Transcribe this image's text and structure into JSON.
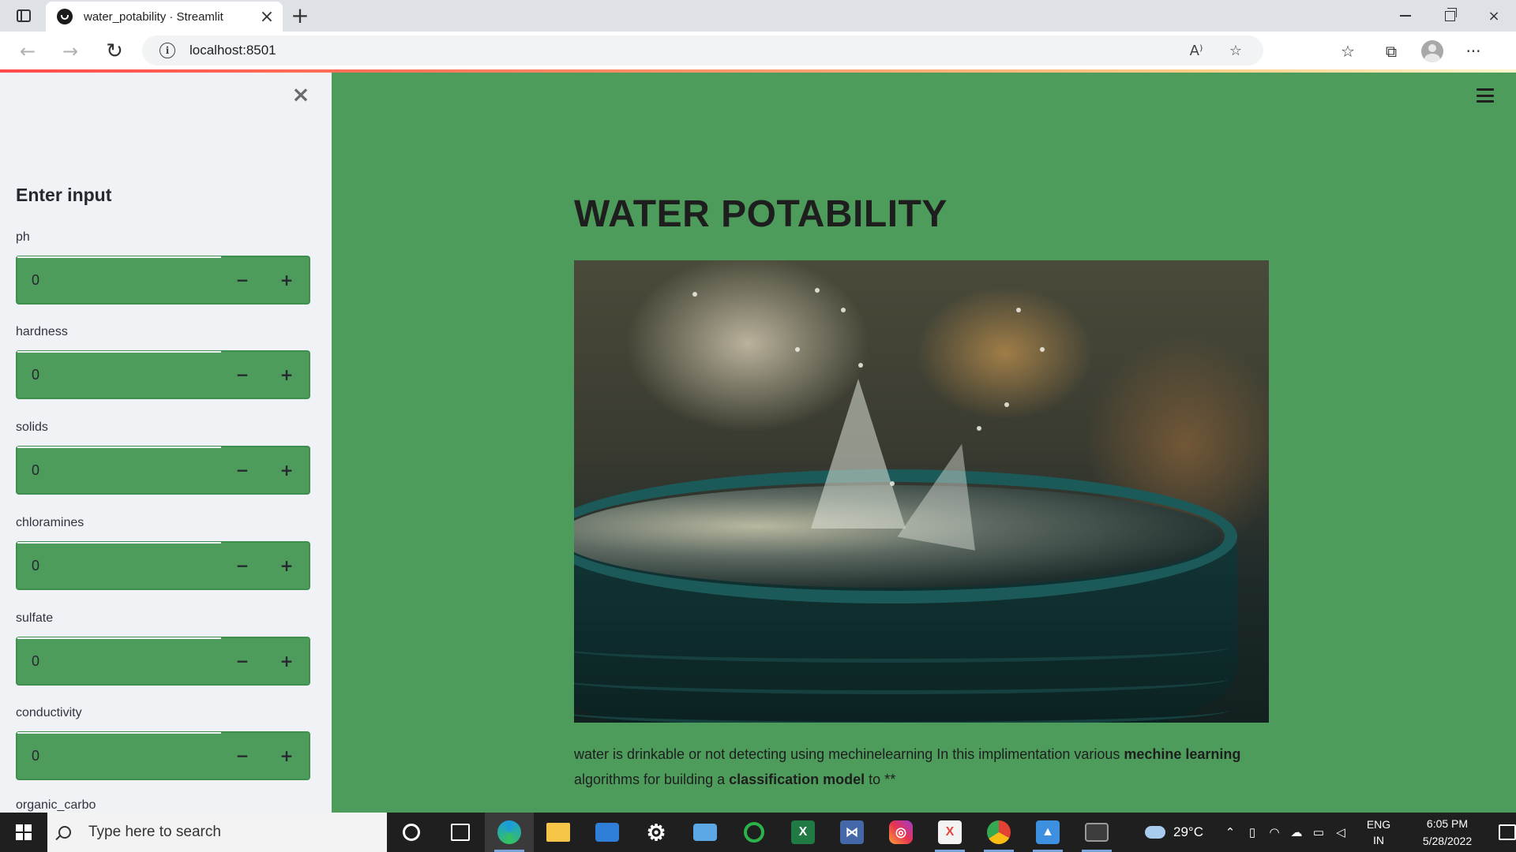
{
  "browser": {
    "tab_title": "water_potability · Streamlit",
    "tab_close_icon": "×",
    "new_tab_icon": "+",
    "url": "localhost:8501",
    "back_icon": "←",
    "forward_icon": "→",
    "reload_icon": "↻",
    "read_aloud_icon": "A⁾",
    "add_favorite_icon": "☆",
    "favorites_icon": "☆",
    "collections_icon": "⧉",
    "more_icon": "···"
  },
  "sidebar": {
    "close_icon": "×",
    "heading": "Enter input",
    "fields": [
      {
        "label": "ph",
        "value": "0"
      },
      {
        "label": "hardness",
        "value": "0"
      },
      {
        "label": "solids",
        "value": "0"
      },
      {
        "label": "chloramines",
        "value": "0"
      },
      {
        "label": "sulfate",
        "value": "0"
      },
      {
        "label": "conductivity",
        "value": "0"
      }
    ],
    "minus": "−",
    "plus": "+",
    "partial_label": "organic_carbo"
  },
  "main": {
    "title": "WATER POTABILITY",
    "description": {
      "part1": "water is drinkable or not detecting using mechinelearning In this implimentation various ",
      "bold1": "mechine learning",
      "part2": " algorithms for building a ",
      "bold2": "classification model",
      "part3": " to **"
    }
  },
  "taskbar": {
    "search_placeholder": "Type here to search",
    "excel_letter": "X",
    "xampp_letter": "X",
    "weather": "29°C",
    "lang_line1": "ENG",
    "lang_line2": "IN",
    "time": "6:05 PM",
    "date": "5/28/2022"
  },
  "colors": {
    "main_bg": "#4d9c5b",
    "sidebar_bg": "#f0f2f6",
    "accent": "#ff4b4b"
  }
}
